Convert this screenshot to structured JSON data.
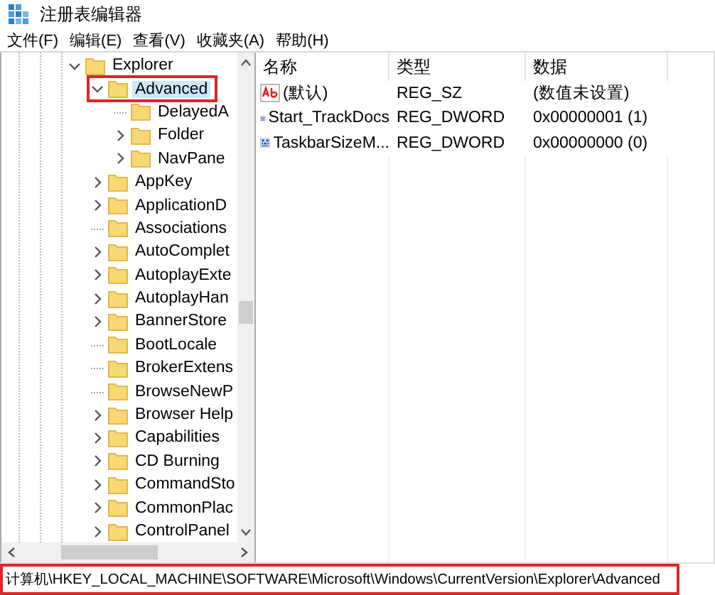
{
  "window": {
    "title": "注册表编辑器"
  },
  "menu": [
    "文件(F)",
    "编辑(E)",
    "查看(V)",
    "收藏夹(A)",
    "帮助(H)"
  ],
  "tree": {
    "items": [
      {
        "label": "Explorer",
        "expandable": true,
        "expanded": true,
        "selected": false,
        "highlighted": false,
        "children": [
          {
            "label": "Advanced",
            "expandable": true,
            "expanded": true,
            "selected": true,
            "highlighted": true,
            "children": [
              {
                "label": "DelayedA",
                "expandable": false,
                "expanded": false,
                "selected": false,
                "highlighted": false
              },
              {
                "label": "Folder",
                "expandable": true,
                "expanded": false,
                "selected": false,
                "highlighted": false
              },
              {
                "label": "NavPane",
                "expandable": true,
                "expanded": false,
                "selected": false,
                "highlighted": false
              }
            ]
          },
          {
            "label": "AppKey",
            "expandable": true,
            "expanded": false,
            "selected": false,
            "highlighted": false
          },
          {
            "label": "ApplicationD",
            "expandable": true,
            "expanded": false,
            "selected": false,
            "highlighted": false
          },
          {
            "label": "Associations",
            "expandable": false,
            "expanded": false,
            "selected": false,
            "highlighted": false
          },
          {
            "label": "AutoComplet",
            "expandable": true,
            "expanded": false,
            "selected": false,
            "highlighted": false
          },
          {
            "label": "AutoplayExte",
            "expandable": true,
            "expanded": false,
            "selected": false,
            "highlighted": false
          },
          {
            "label": "AutoplayHan",
            "expandable": true,
            "expanded": false,
            "selected": false,
            "highlighted": false
          },
          {
            "label": "BannerStore",
            "expandable": true,
            "expanded": false,
            "selected": false,
            "highlighted": false
          },
          {
            "label": "BootLocale",
            "expandable": false,
            "expanded": false,
            "selected": false,
            "highlighted": false
          },
          {
            "label": "BrokerExtens",
            "expandable": false,
            "expanded": false,
            "selected": false,
            "highlighted": false
          },
          {
            "label": "BrowseNewP",
            "expandable": false,
            "expanded": false,
            "selected": false,
            "highlighted": false
          },
          {
            "label": "Browser Help",
            "expandable": true,
            "expanded": false,
            "selected": false,
            "highlighted": false
          },
          {
            "label": "Capabilities",
            "expandable": true,
            "expanded": false,
            "selected": false,
            "highlighted": false
          },
          {
            "label": "CD Burning",
            "expandable": true,
            "expanded": false,
            "selected": false,
            "highlighted": false
          },
          {
            "label": "CommandSto",
            "expandable": true,
            "expanded": false,
            "selected": false,
            "highlighted": false
          },
          {
            "label": "CommonPlac",
            "expandable": true,
            "expanded": false,
            "selected": false,
            "highlighted": false
          },
          {
            "label": "ControlPanel",
            "expandable": true,
            "expanded": false,
            "selected": false,
            "highlighted": false
          }
        ]
      }
    ]
  },
  "table": {
    "columns": [
      "名称",
      "类型",
      "数据"
    ],
    "rows": [
      {
        "kind": "string",
        "name": "(默认)",
        "type": "REG_SZ",
        "data": "(数值未设置)"
      },
      {
        "kind": "dword",
        "name": "Start_TrackDocs",
        "type": "REG_DWORD",
        "data": "0x00000001 (1)"
      },
      {
        "kind": "dword",
        "name": "TaskbarSizeM...",
        "type": "REG_DWORD",
        "data": "0x00000000 (0)"
      }
    ]
  },
  "status_bar": {
    "path": "计算机\\HKEY_LOCAL_MACHINE\\SOFTWARE\\Microsoft\\Windows\\CurrentVersion\\Explorer\\Advanced",
    "highlighted": true
  }
}
